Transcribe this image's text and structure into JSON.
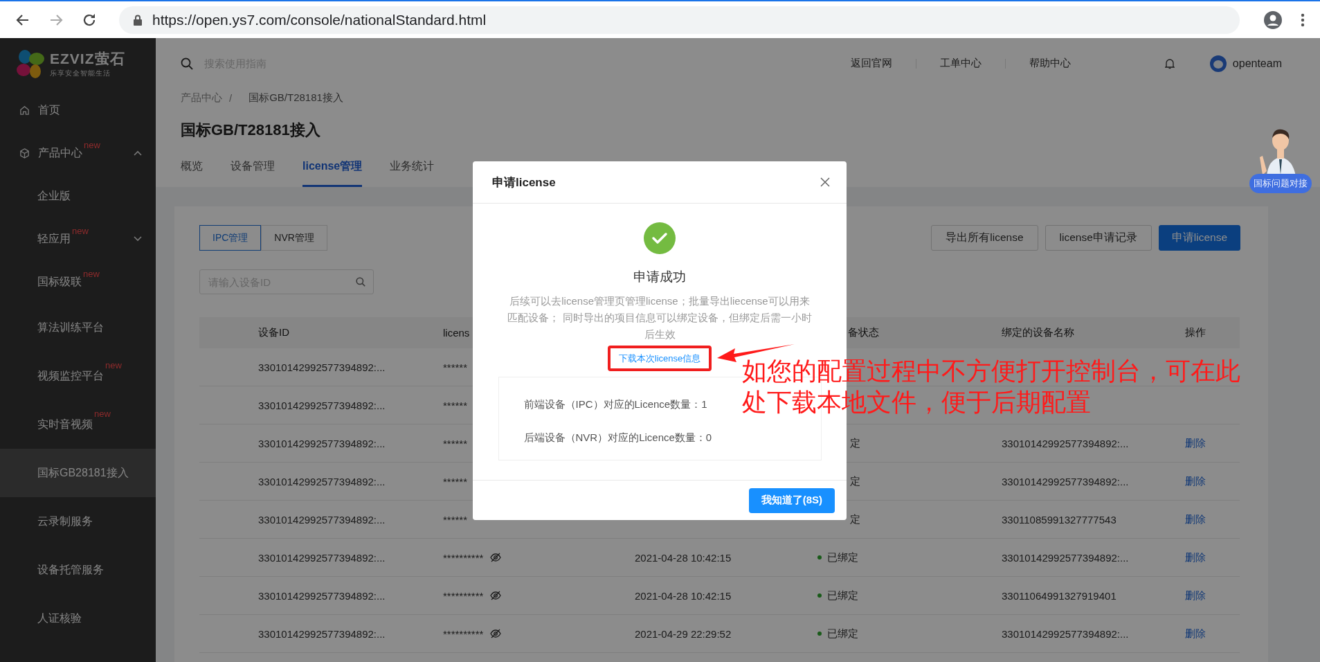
{
  "browser": {
    "url": "https://open.ys7.com/console/nationalStandard.html"
  },
  "sidebar": {
    "logo": {
      "name": "EZVIZ萤石",
      "tagline": "乐享安全智能生活"
    },
    "items": [
      {
        "label": "首页",
        "kind": "home",
        "selected": false
      },
      {
        "label": "产品中心",
        "kind": "group",
        "badge": "new",
        "expanded": true,
        "selected": false,
        "children": [
          {
            "label": "企业版",
            "selected": false
          },
          {
            "label": "轻应用",
            "badge": "new",
            "expanded": false,
            "selected": false
          },
          {
            "label": "国标级联",
            "badge": "new",
            "selected": false
          },
          {
            "label": "算法训练平台",
            "selected": false
          },
          {
            "label": "视频监控平台",
            "badge": "new",
            "selected": false
          },
          {
            "label": "实时音视频",
            "badge": "new",
            "selected": false
          },
          {
            "label": "国标GB28181接入",
            "selected": true
          },
          {
            "label": "云录制服务",
            "selected": false
          },
          {
            "label": "设备托管服务",
            "selected": false
          },
          {
            "label": "人证核验",
            "selected": false
          }
        ]
      }
    ]
  },
  "header": {
    "search_placeholder": "搜索使用指南",
    "links": [
      "返回官网",
      "工单中心",
      "帮助中心"
    ],
    "user": "openteam"
  },
  "breadcrumb": {
    "items": [
      "产品中心",
      "国标GB/T28181接入"
    ],
    "separator": "/"
  },
  "page_title": "国标GB/T28181接入",
  "tabs": [
    {
      "label": "概览",
      "selected": false
    },
    {
      "label": "设备管理",
      "selected": false
    },
    {
      "label": "license管理",
      "selected": true
    },
    {
      "label": "业务统计",
      "selected": false
    }
  ],
  "segments": [
    {
      "label": "IPC管理",
      "selected": true
    },
    {
      "label": "NVR管理",
      "selected": false
    }
  ],
  "toolbar_buttons": [
    {
      "label": "导出所有license",
      "kind": "default"
    },
    {
      "label": "license申请记录",
      "kind": "default"
    },
    {
      "label": "申请license",
      "kind": "primary"
    }
  ],
  "device_search": {
    "placeholder": "请输入设备ID"
  },
  "table": {
    "columns": {
      "device_id": "设备ID",
      "license": "licens",
      "status": "备状态",
      "bound_name": "绑定的设备名称",
      "action": "操作"
    },
    "rows": [
      {
        "device_id": "33010142992577394892:...",
        "license": "******"
      },
      {
        "device_id": "33010142992577394892:...",
        "license": "******"
      },
      {
        "device_id": "33010142992577394892:...",
        "license": "******",
        "status": "定",
        "dot": false,
        "bound_name": "33010142992577394892:...",
        "action": "删除"
      },
      {
        "device_id": "33010142992577394892:...",
        "license": "******",
        "status": "定",
        "dot": false,
        "bound_name": "33010142992577394892:...",
        "action": "删除"
      },
      {
        "device_id": "33010142992577394892:...",
        "license": "******",
        "status": "定",
        "dot": false,
        "bound_name": "33011085991327777543",
        "action": "删除"
      },
      {
        "device_id": "33010142992577394892:...",
        "license": "**********",
        "time": "2021-04-28 10:42:15",
        "status": "已绑定",
        "dot": true,
        "bound_name": "33010142992577394892:...",
        "action": "删除"
      },
      {
        "device_id": "33010142992577394892:...",
        "license": "**********",
        "time": "2021-04-28 10:42:15",
        "status": "已绑定",
        "dot": true,
        "bound_name": "33011064991327919401",
        "action": "删除"
      },
      {
        "device_id": "33010142992577394892:...",
        "license": "**********",
        "time": "2021-04-29 22:29:52",
        "status": "已绑定",
        "dot": true,
        "bound_name": "33010142992577394892:...",
        "action": "删除"
      }
    ]
  },
  "modal": {
    "title": "申请license",
    "status": "申请成功",
    "description": "后续可以去license管理页管理license；批量导出liecense可以用来匹配设备； 同时导出的项目信息可以绑定设备，但绑定后需一小时后生效",
    "download_link": "下载本次license信息",
    "info_lines": [
      "前端设备（IPC）对应的Licence数量：1",
      "后端设备（NVR）对应的Licence数量：0"
    ],
    "confirm": "我知道了(8S)"
  },
  "annotation": {
    "text": "如您的配置过程中不方便打开控制台，可在此处下载本地文件，便于后期配置"
  },
  "helper": {
    "label": "国标问题对接"
  }
}
